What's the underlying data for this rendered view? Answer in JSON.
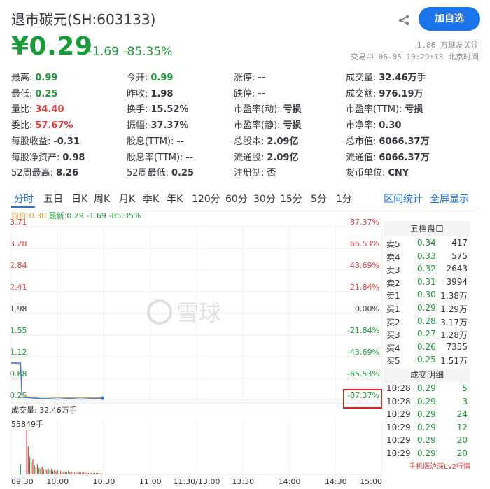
{
  "header": {
    "title": "退市碳元(SH:603133)",
    "follow_label": "加自选"
  },
  "quote": {
    "price": "¥0.29",
    "change": "-1.69 -85.35%",
    "followers": "1.86 万球友关注",
    "trade_time": "交易中 06-05 10:29:13 北京时间"
  },
  "stats": [
    [
      {
        "label": "最高:",
        "value": "0.99",
        "color": "green"
      },
      {
        "label": "今开:",
        "value": "0.99",
        "color": "green"
      },
      {
        "label": "涨停:",
        "value": "--",
        "color": "dark"
      },
      {
        "label": "成交量:",
        "value": "32.46万手",
        "color": "dark"
      }
    ],
    [
      {
        "label": "最低:",
        "value": "0.25",
        "color": "green"
      },
      {
        "label": "昨收:",
        "value": "1.98",
        "color": "dark"
      },
      {
        "label": "跌停:",
        "value": "--",
        "color": "dark"
      },
      {
        "label": "成交额:",
        "value": "976.19万",
        "color": "dark"
      }
    ],
    [
      {
        "label": "量比:",
        "value": "34.40",
        "color": "red"
      },
      {
        "label": "换手:",
        "value": "15.52%",
        "color": "dark"
      },
      {
        "label": "市盈率(动):",
        "value": "亏损",
        "color": "dark"
      },
      {
        "label": "市盈率(TTM):",
        "value": "亏损",
        "color": "dark"
      }
    ],
    [
      {
        "label": "委比:",
        "value": "57.67%",
        "color": "red"
      },
      {
        "label": "振幅:",
        "value": "37.37%",
        "color": "dark"
      },
      {
        "label": "市盈率(静):",
        "value": "亏损",
        "color": "dark"
      },
      {
        "label": "市净率:",
        "value": "0.30",
        "color": "dark"
      }
    ],
    [
      {
        "label": "每股收益:",
        "value": "-0.31",
        "color": "dark"
      },
      {
        "label": "股息(TTM):",
        "value": "--",
        "color": "dark"
      },
      {
        "label": "总股本:",
        "value": "2.09亿",
        "color": "dark"
      },
      {
        "label": "总市值:",
        "value": "6066.37万",
        "color": "dark"
      }
    ],
    [
      {
        "label": "每股净资产:",
        "value": "0.98",
        "color": "dark"
      },
      {
        "label": "股息率(TTM):",
        "value": "--",
        "color": "dark"
      },
      {
        "label": "流通股:",
        "value": "2.09亿",
        "color": "dark"
      },
      {
        "label": "流通值:",
        "value": "6066.37万",
        "color": "dark"
      }
    ],
    [
      {
        "label": "52周最高:",
        "value": "8.26",
        "color": "dark"
      },
      {
        "label": "52周最低:",
        "value": "0.25",
        "color": "dark"
      },
      {
        "label": "注册制:",
        "value": "否",
        "color": "dark"
      },
      {
        "label": "货币单位:",
        "value": "CNY",
        "color": "dark"
      }
    ]
  ],
  "tabs": [
    "分时",
    "五日",
    "日K",
    "周K",
    "月K",
    "季K",
    "年K",
    "120分",
    "60分",
    "30分",
    "15分",
    "5分",
    "1分"
  ],
  "tab_links": [
    "区间统计",
    "全屏显示"
  ],
  "legend": {
    "avg": "均价:0.30",
    "latest": "最新:0.29 -1.69 -85.35%"
  },
  "watermark": "雪球",
  "chart_data": {
    "type": "line",
    "price_ticks": [
      "3.71",
      "3.28",
      "2.84",
      "2.41",
      "1.98",
      "1.55",
      "1.12",
      "0.68",
      "0.25"
    ],
    "pct_ticks": [
      "87.37%",
      "65.53%",
      "43.69%",
      "21.84%",
      "0.00%",
      "-21.84%",
      "-43.69%",
      "-65.53%",
      "-87.37%"
    ],
    "time_ticks": [
      "09:30",
      "10:00",
      "10:30",
      "11:00",
      "11:30/13:00",
      "13:30",
      "14:00",
      "14:30",
      "15:00"
    ],
    "ylim": [
      0.25,
      3.71
    ],
    "minutes_total": 240,
    "price_series": [
      [
        0,
        0.99
      ],
      [
        1,
        0.99
      ],
      [
        2,
        0.99
      ],
      [
        3,
        0.99
      ],
      [
        4,
        0.99
      ],
      [
        5,
        0.99
      ],
      [
        6,
        0.99
      ],
      [
        7,
        0.32
      ],
      [
        8,
        0.31
      ],
      [
        10,
        0.3
      ],
      [
        12,
        0.3
      ],
      [
        14,
        0.29
      ],
      [
        16,
        0.29
      ],
      [
        20,
        0.28
      ],
      [
        25,
        0.28
      ],
      [
        30,
        0.27
      ],
      [
        35,
        0.28
      ],
      [
        40,
        0.28
      ],
      [
        45,
        0.27
      ],
      [
        50,
        0.28
      ],
      [
        55,
        0.28
      ],
      [
        59,
        0.29
      ]
    ],
    "avg_series": [
      [
        0,
        0.99
      ],
      [
        3,
        0.98
      ],
      [
        6,
        0.95
      ],
      [
        7,
        0.38
      ],
      [
        8,
        0.34
      ],
      [
        10,
        0.32
      ],
      [
        15,
        0.31
      ],
      [
        20,
        0.31
      ],
      [
        30,
        0.3
      ],
      [
        40,
        0.3
      ],
      [
        50,
        0.3
      ],
      [
        59,
        0.3
      ]
    ],
    "volume_label": "成交量: 32.46万手",
    "volume_max_label": "55849手",
    "volume_max": 55849,
    "volume_series": [
      [
        6,
        13000
      ],
      [
        10,
        55849
      ],
      [
        11,
        35000
      ],
      [
        12,
        22000
      ],
      [
        13,
        15000
      ],
      [
        14,
        19000
      ],
      [
        15,
        12000
      ],
      [
        16,
        9000
      ],
      [
        17,
        13000
      ],
      [
        18,
        8000
      ],
      [
        19,
        7000
      ],
      [
        20,
        9500
      ],
      [
        21,
        6000
      ],
      [
        22,
        8000
      ],
      [
        23,
        5500
      ],
      [
        24,
        7000
      ],
      [
        25,
        5000
      ],
      [
        26,
        6500
      ],
      [
        27,
        4500
      ],
      [
        28,
        5500
      ],
      [
        29,
        4000
      ],
      [
        30,
        5000
      ],
      [
        31,
        3500
      ],
      [
        32,
        4500
      ],
      [
        33,
        3000
      ],
      [
        34,
        4000
      ],
      [
        35,
        3500
      ],
      [
        36,
        3000
      ],
      [
        37,
        4500
      ],
      [
        38,
        2500
      ],
      [
        39,
        3500
      ],
      [
        40,
        3000
      ],
      [
        41,
        2500
      ],
      [
        42,
        3500
      ],
      [
        43,
        2000
      ],
      [
        44,
        3000
      ],
      [
        45,
        2500
      ],
      [
        46,
        2000
      ],
      [
        47,
        3000
      ],
      [
        48,
        2000
      ],
      [
        49,
        2500
      ],
      [
        50,
        1800
      ],
      [
        51,
        2500
      ],
      [
        52,
        2000
      ],
      [
        53,
        1500
      ],
      [
        54,
        2000
      ],
      [
        55,
        1500
      ],
      [
        56,
        1800
      ],
      [
        57,
        1200
      ],
      [
        58,
        1500
      ],
      [
        59,
        1000
      ]
    ]
  },
  "orderbook": {
    "title": "五档盘口",
    "rows": [
      {
        "label": "卖5",
        "price": "0.34",
        "vol": "417"
      },
      {
        "label": "卖4",
        "price": "0.33",
        "vol": "575"
      },
      {
        "label": "卖3",
        "price": "0.32",
        "vol": "2643"
      },
      {
        "label": "卖2",
        "price": "0.31",
        "vol": "3994"
      },
      {
        "label": "卖1",
        "price": "0.30",
        "vol": "1.38万"
      },
      {
        "label": "买1",
        "price": "0.29",
        "vol": "1.29万"
      },
      {
        "label": "买2",
        "price": "0.28",
        "vol": "3.17万"
      },
      {
        "label": "买3",
        "price": "0.27",
        "vol": "1.28万"
      },
      {
        "label": "买4",
        "price": "0.26",
        "vol": "7355"
      },
      {
        "label": "买5",
        "price": "0.25",
        "vol": "1.51万"
      }
    ]
  },
  "trades": {
    "title": "成交明细",
    "rows": [
      {
        "time": "10:28",
        "price": "0.29",
        "vol": "5"
      },
      {
        "time": "10:28",
        "price": "0.29",
        "vol": "3"
      },
      {
        "time": "10:29",
        "price": "0.29",
        "vol": "24"
      },
      {
        "time": "10:29",
        "price": "0.29",
        "vol": "12"
      },
      {
        "time": "10:29",
        "price": "0.29",
        "vol": "20"
      },
      {
        "time": "10:29",
        "price": "0.29",
        "vol": "20"
      }
    ],
    "mobile_link": "手机版沪深Lv2行情"
  },
  "colors": {
    "green": "#1b9a3a",
    "red": "#e23d3d",
    "blue": "#1a73e8",
    "avg_line": "#f0a030",
    "price_line": "#2d7be0"
  }
}
